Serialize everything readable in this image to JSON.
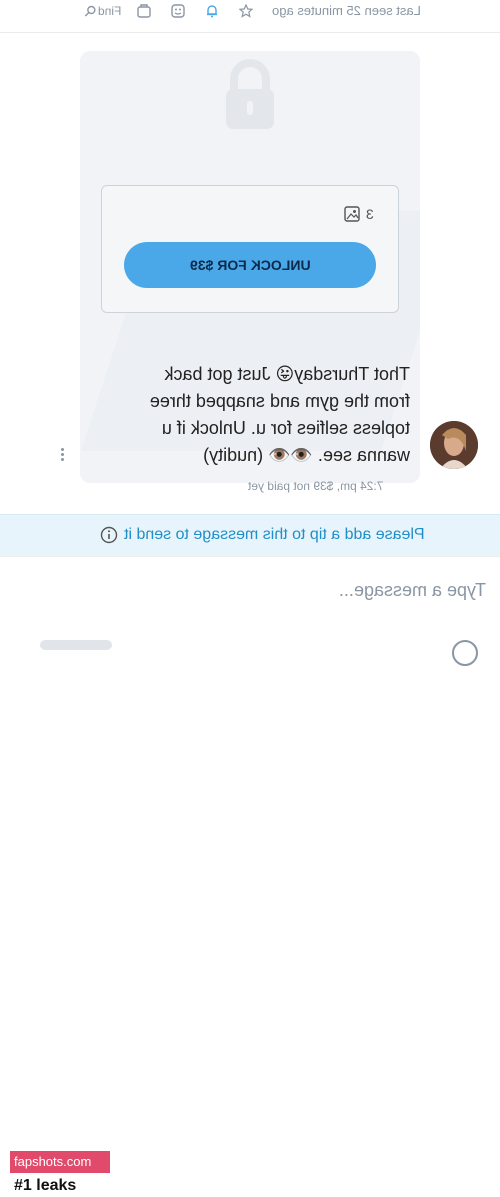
{
  "header": {
    "status": "Last seen 25 minutes ago",
    "find_label": "Find",
    "icons": [
      "star-icon",
      "bell-icon",
      "emoji-icon",
      "gallery-icon",
      "search-icon"
    ]
  },
  "message": {
    "media_count": "3",
    "unlock_button_label": "UNLOCK FOR $39",
    "text": "Thot Thursday😜 Just got back\nfrom the gym and snapped three\ntopless selfies for u. Unlock if u\nwanna see. 👁️👁️ (nudity)",
    "meta": "7:24 pm, $39 not paid yet"
  },
  "tip_notice": {
    "text": "Please add a tip to this message to send it"
  },
  "composer": {
    "placeholder": "Type a message..."
  },
  "watermark": {
    "site": "fapshots.com",
    "tagline": "#1 leaks"
  },
  "colors": {
    "accent": "#4aa8e8",
    "tip_bg": "#e7f4fb",
    "tip_text": "#1f8ec9",
    "muted": "#8a96a3"
  }
}
